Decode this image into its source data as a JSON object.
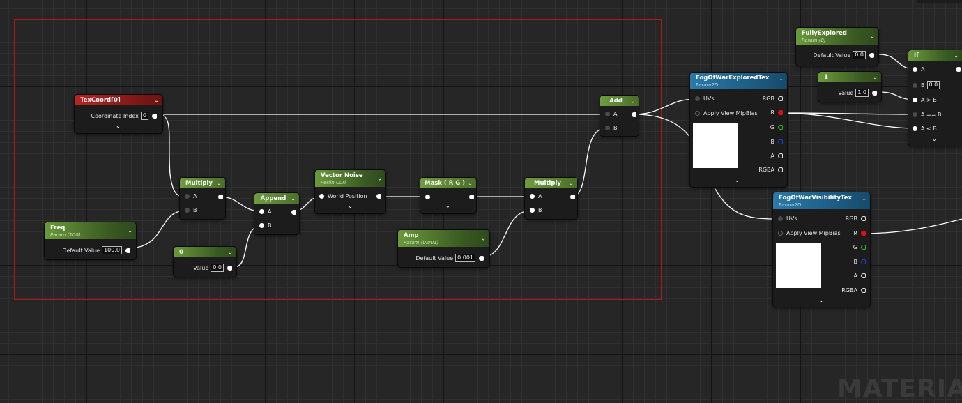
{
  "nodes": {
    "texcoord": {
      "title": "TexCoord[0]",
      "input_label": "Coordinate Index",
      "input_value": "0"
    },
    "multiply1": {
      "title": "Multiply",
      "pin_a": "A",
      "pin_b": "B"
    },
    "freq": {
      "title": "Freq",
      "subtitle": "Param (100)",
      "input_label": "Default Value",
      "input_value": "100.0"
    },
    "append": {
      "title": "Append",
      "pin_a": "A",
      "pin_b": "B"
    },
    "zero": {
      "title": "0",
      "input_label": "Value",
      "input_value": "0.0"
    },
    "vector_noise": {
      "title": "Vector Noise",
      "subtitle": "Perlin Curl",
      "pin_label": "World Position"
    },
    "mask": {
      "title": "Mask ( R G )"
    },
    "amp": {
      "title": "Amp",
      "subtitle": "Param (0.001)",
      "input_label": "Default Value",
      "input_value": "0.001"
    },
    "multiply2": {
      "title": "Multiply",
      "pin_a": "A",
      "pin_b": "B"
    },
    "add": {
      "title": "Add",
      "pin_a": "A",
      "pin_b": "B"
    },
    "explored_tex": {
      "title": "FogOfWarExploredTex",
      "subtitle": "Param2D",
      "in_uvs": "UVs",
      "in_mipbias": "Apply View MipBias",
      "out_rgb": "RGB",
      "out_r": "R",
      "out_g": "G",
      "out_b": "B",
      "out_a": "A",
      "out_rgba": "RGBA"
    },
    "visibility_tex": {
      "title": "FogOfWarVisibilityTex",
      "subtitle": "Param2D",
      "in_uvs": "UVs",
      "in_mipbias": "Apply View MipBias",
      "out_rgb": "RGB",
      "out_r": "R",
      "out_g": "G",
      "out_b": "B",
      "out_a": "A",
      "out_rgba": "RGBA"
    },
    "fully_explored": {
      "title": "FullyExplored",
      "subtitle": "Param (0)",
      "input_label": "Default Value",
      "input_value": "0.0"
    },
    "one": {
      "title": "1",
      "input_label": "Value",
      "input_value": "1.0"
    },
    "if_node": {
      "title": "If",
      "pin_a": "A",
      "pin_b": "B",
      "pin_b_value": "0.0",
      "pin_agb": "A > B",
      "pin_aeb": "A == B",
      "pin_alb": "A < B"
    }
  },
  "watermark": "MATERIAL",
  "colors": {
    "param_green": "#6a9a3a",
    "texcoord_red": "#b82424",
    "texture_blue": "#2a7aa8",
    "comment_border": "#b01818",
    "wire": "#ffffff"
  }
}
